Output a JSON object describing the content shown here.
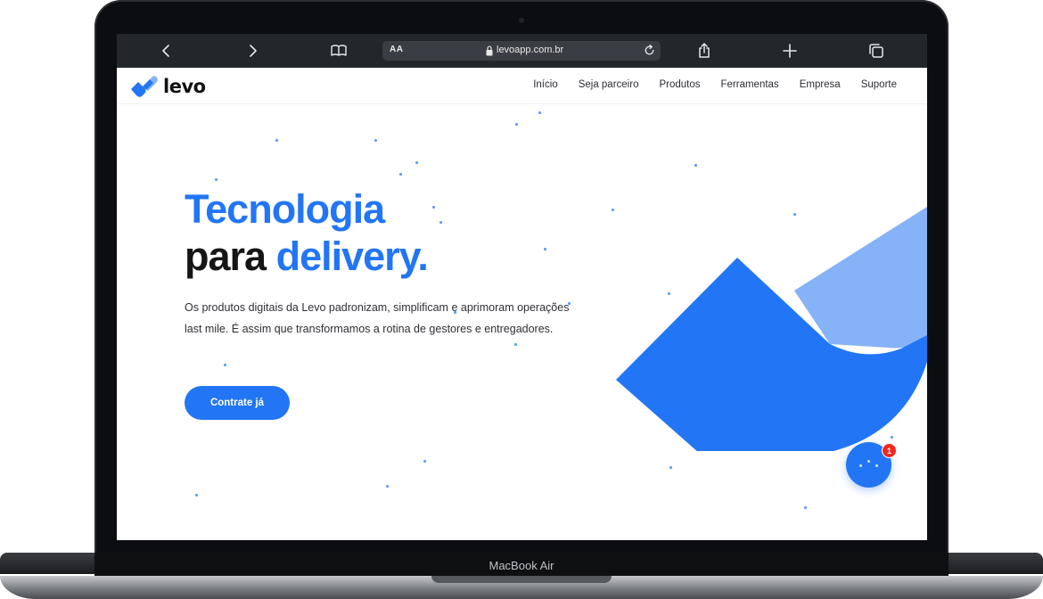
{
  "device": {
    "label": "MacBook Air"
  },
  "browser": {
    "text_size_label": "AA",
    "url": "levoapp.com.br",
    "icons": [
      "chevron-left-icon",
      "chevron-right-icon",
      "book-icon",
      "lock-icon",
      "reload-icon",
      "share-icon",
      "plus-icon",
      "tabs-icon"
    ]
  },
  "site": {
    "logo_text": "levo",
    "nav": [
      "Início",
      "Seja parceiro",
      "Produtos",
      "Ferramentas",
      "Empresa",
      "Suporte"
    ],
    "hero": {
      "title_line1": "Tecnologia",
      "title_line2_dark": "para",
      "title_line2_blue": "delivery.",
      "description": "Os produtos digitais da Levo padronizam, simplificam e aprimoram operações last mile. É assim que transformamos a rotina de gestores e entregadores.",
      "cta": "Contrate  já"
    },
    "chat": {
      "badge_count": "1"
    },
    "colors": {
      "accent": "#2276f5",
      "accent_light": "#86b2f7",
      "badge": "#f2271e",
      "text_dark": "#151515"
    }
  }
}
